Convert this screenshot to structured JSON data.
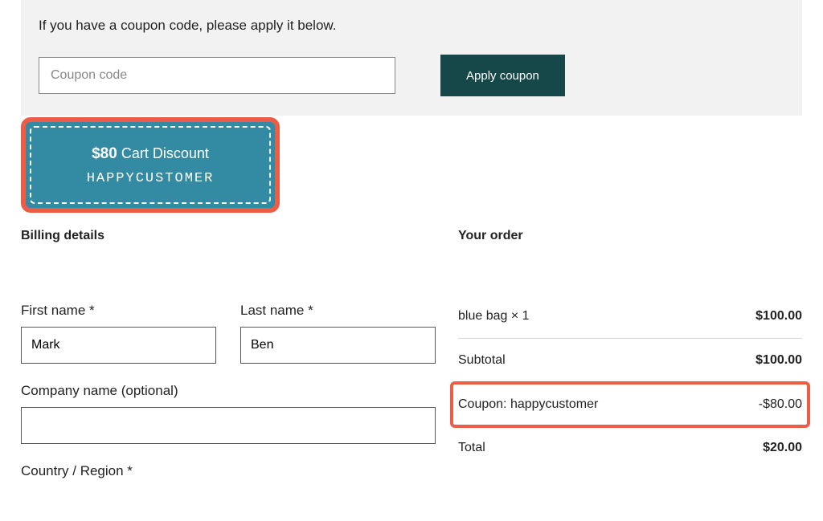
{
  "coupon": {
    "instruction": "If you have a coupon code, please apply it below.",
    "placeholder": "Coupon code",
    "apply_label": "Apply coupon"
  },
  "coupon_badge": {
    "amount": "$80",
    "label": "Cart Discount",
    "code": "HAPPYCUSTOMER"
  },
  "billing": {
    "title": "Billing details",
    "first_name_label": "First name *",
    "first_name_value": "Mark",
    "last_name_label": "Last name *",
    "last_name_value": "Ben",
    "company_label": "Company name (optional)",
    "company_value": "",
    "country_label": "Country / Region *"
  },
  "order": {
    "title": "Your order",
    "rows": [
      {
        "label": "blue bag  × 1",
        "value": "$100.00"
      },
      {
        "label": "Subtotal",
        "value": "$100.00"
      },
      {
        "label": "Coupon: happycustomer",
        "value": "-$80.00"
      },
      {
        "label": "Total",
        "value": "$20.00"
      }
    ]
  }
}
